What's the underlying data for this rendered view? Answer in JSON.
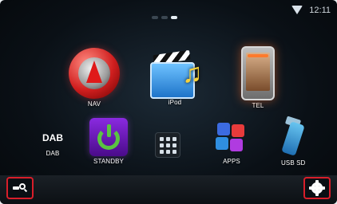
{
  "status": {
    "time": "12:11",
    "wifi": "wifi-icon"
  },
  "pager": {
    "pages": 3,
    "active_index": 2
  },
  "apps": [
    {
      "id": "nav",
      "label": "NAV",
      "icon": "nav-icon"
    },
    {
      "id": "ipod",
      "label": "iPod",
      "icon": "ipod-icon"
    },
    {
      "id": "tel",
      "label": "TEL",
      "icon": "tel-icon"
    },
    {
      "id": "dab",
      "label": "DAB",
      "icon": "dab-icon",
      "icon_text": "DAB"
    },
    {
      "id": "standby",
      "label": "STANDBY",
      "icon": "standby-icon"
    },
    {
      "id": "grid",
      "label": "",
      "icon": "app-grid-icon"
    },
    {
      "id": "apps",
      "label": "APPS",
      "icon": "apps-icon"
    },
    {
      "id": "usbsd",
      "label": "USB SD",
      "icon": "usb-sd-icon"
    }
  ],
  "bottom_bar": {
    "left_button_icon": "search-icon",
    "right_button_icon": "gear-icon",
    "highlight_color": "#d81e2a"
  }
}
